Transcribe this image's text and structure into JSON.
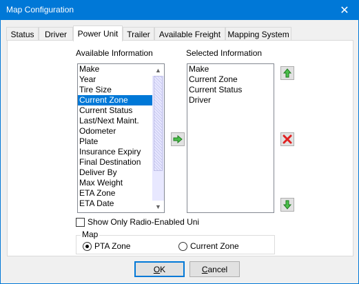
{
  "window": {
    "title": "Map Configuration",
    "close_glyph": "✕"
  },
  "tabs": [
    {
      "label": "Status"
    },
    {
      "label": "Driver"
    },
    {
      "label": "Power Unit"
    },
    {
      "label": "Trailer"
    },
    {
      "label": "Available Freight"
    },
    {
      "label": "Mapping System"
    }
  ],
  "available": {
    "heading": "Available Information",
    "items": [
      "Make",
      "Year",
      "Tire Size",
      "Current Zone",
      "Current Status",
      "Last/Next Maint.",
      "Odometer",
      "Plate",
      "Insurance Expiry",
      "Final Destination",
      "Deliver By",
      "Max Weight",
      "ETA Zone",
      "ETA Date"
    ],
    "selected_index": 3
  },
  "selected": {
    "heading": "Selected Information",
    "items": [
      "Make",
      "Current Zone",
      "Current Status",
      "Driver"
    ]
  },
  "icons": {
    "add": "green-right-arrow-icon",
    "up": "green-up-arrow-icon",
    "remove": "red-x-icon",
    "down": "green-down-arrow-icon"
  },
  "checkbox_label": "Show Only Radio-Enabled Uni",
  "map_group": {
    "title": "Map",
    "options": [
      {
        "label": "PTA Zone",
        "checked": true
      },
      {
        "label": "Current Zone",
        "checked": false
      }
    ]
  },
  "buttons": {
    "ok_pre": "",
    "ok_ul": "O",
    "ok_post": "K",
    "cancel_pre": "",
    "cancel_ul": "C",
    "cancel_post": "ancel"
  },
  "colors": {
    "accent": "#0078d7",
    "green": "#33aa33",
    "red": "#e02020"
  }
}
